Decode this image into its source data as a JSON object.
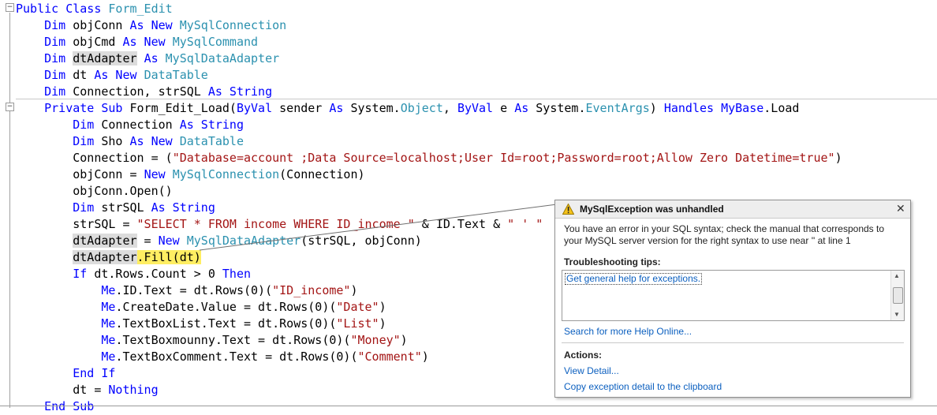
{
  "code": {
    "lines": [
      [
        {
          "t": "Public Class ",
          "c": "kw"
        },
        {
          "t": "Form_Edit",
          "c": "ty"
        }
      ],
      [
        {
          "t": "    Dim ",
          "c": "kw"
        },
        {
          "t": "objConn "
        },
        {
          "t": "As New ",
          "c": "kw"
        },
        {
          "t": "MySqlConnection",
          "c": "ty"
        }
      ],
      [
        {
          "t": "    Dim ",
          "c": "kw"
        },
        {
          "t": "objCmd "
        },
        {
          "t": "As New ",
          "c": "kw"
        },
        {
          "t": "MySqlCommand",
          "c": "ty"
        }
      ],
      [
        {
          "t": "    Dim ",
          "c": "kw"
        },
        {
          "t": "dtAdapter",
          "c": "hl"
        },
        {
          "t": " "
        },
        {
          "t": "As ",
          "c": "kw"
        },
        {
          "t": "MySqlDataAdapter",
          "c": "ty"
        }
      ],
      [
        {
          "t": "    Dim ",
          "c": "kw"
        },
        {
          "t": "dt "
        },
        {
          "t": "As New ",
          "c": "kw"
        },
        {
          "t": "DataTable",
          "c": "ty"
        }
      ],
      [
        {
          "t": "    Dim ",
          "c": "kw"
        },
        {
          "t": "Connection, strSQL "
        },
        {
          "t": "As String",
          "c": "kw"
        }
      ],
      [
        {
          "t": "    Private Sub ",
          "c": "kw"
        },
        {
          "t": "Form_Edit_Load("
        },
        {
          "t": "ByVal ",
          "c": "kw"
        },
        {
          "t": "sender "
        },
        {
          "t": "As ",
          "c": "kw"
        },
        {
          "t": "System."
        },
        {
          "t": "Object",
          "c": "ty"
        },
        {
          "t": ", "
        },
        {
          "t": "ByVal ",
          "c": "kw"
        },
        {
          "t": "e "
        },
        {
          "t": "As ",
          "c": "kw"
        },
        {
          "t": "System."
        },
        {
          "t": "EventArgs",
          "c": "ty"
        },
        {
          "t": ") "
        },
        {
          "t": "Handles MyBase",
          "c": "kw"
        },
        {
          "t": ".Load"
        }
      ],
      [
        {
          "t": "        Dim ",
          "c": "kw"
        },
        {
          "t": "Connection "
        },
        {
          "t": "As String",
          "c": "kw"
        }
      ],
      [
        {
          "t": "        Dim ",
          "c": "kw"
        },
        {
          "t": "Sho "
        },
        {
          "t": "As New ",
          "c": "kw"
        },
        {
          "t": "DataTable",
          "c": "ty"
        }
      ],
      [
        {
          "t": "        Connection = ("
        },
        {
          "t": "\"Database=account ;Data Source=localhost;User Id=root;Password=root;Allow Zero Datetime=true\"",
          "c": "st"
        },
        {
          "t": ")"
        }
      ],
      [
        {
          "t": "        objConn = "
        },
        {
          "t": "New ",
          "c": "kw"
        },
        {
          "t": "MySqlConnection",
          "c": "ty"
        },
        {
          "t": "(Connection)"
        }
      ],
      [
        {
          "t": "        objConn.Open()"
        }
      ],
      [
        {
          "t": "        Dim ",
          "c": "kw"
        },
        {
          "t": "strSQL "
        },
        {
          "t": "As String",
          "c": "kw"
        }
      ],
      [
        {
          "t": "        strSQL = "
        },
        {
          "t": "\"SELECT * FROM income WHERE ID_income \"",
          "c": "st"
        },
        {
          "t": " & ID.Text & "
        },
        {
          "t": "\" ' \"",
          "c": "st"
        }
      ],
      [
        {
          "t": "        "
        },
        {
          "t": "dtAdapter",
          "c": "hl"
        },
        {
          "t": " = "
        },
        {
          "t": "New ",
          "c": "kw"
        },
        {
          "t": "MySqlDataAdapter",
          "c": "ty"
        },
        {
          "t": "(strSQL, objConn)"
        }
      ],
      [
        {
          "t": "        "
        },
        {
          "t": "dtAdapter",
          "c": "hl"
        },
        {
          "t": ".Fill(dt)",
          "c": "cur"
        }
      ],
      [
        {
          "t": "        If ",
          "c": "kw"
        },
        {
          "t": "dt.Rows.Count > 0 "
        },
        {
          "t": "Then",
          "c": "kw"
        }
      ],
      [
        {
          "t": "            Me",
          "c": "kw"
        },
        {
          "t": ".ID.Text = dt.Rows(0)("
        },
        {
          "t": "\"ID_income\"",
          "c": "st"
        },
        {
          "t": ")"
        }
      ],
      [
        {
          "t": "            Me",
          "c": "kw"
        },
        {
          "t": ".CreateDate.Value = dt.Rows(0)("
        },
        {
          "t": "\"Date\"",
          "c": "st"
        },
        {
          "t": ")"
        }
      ],
      [
        {
          "t": "            Me",
          "c": "kw"
        },
        {
          "t": ".TextBoxList.Text = dt.Rows(0)("
        },
        {
          "t": "\"List\"",
          "c": "st"
        },
        {
          "t": ")"
        }
      ],
      [
        {
          "t": "            Me",
          "c": "kw"
        },
        {
          "t": ".TextBoxmounny.Text = dt.Rows(0)("
        },
        {
          "t": "\"Money\"",
          "c": "st"
        },
        {
          "t": ")"
        }
      ],
      [
        {
          "t": "            Me",
          "c": "kw"
        },
        {
          "t": ".TextBoxComment.Text = dt.Rows(0)("
        },
        {
          "t": "\"Comment\"",
          "c": "st"
        },
        {
          "t": ")"
        }
      ],
      [
        {
          "t": "        End If",
          "c": "kw"
        }
      ],
      [
        {
          "t": "        dt = "
        },
        {
          "t": "Nothing",
          "c": "kw"
        }
      ],
      [
        {
          "t": "    End Sub",
          "c": "kw"
        }
      ]
    ]
  },
  "gutter": {
    "fold_glyph": "−"
  },
  "exception": {
    "title": "MySqlException was unhandled",
    "close": "✕",
    "message": "You have an error in your SQL syntax; check the manual that corresponds to your MySQL server version for the right syntax to use near '' at line 1",
    "tips_title": "Troubleshooting tips:",
    "tips": [
      "Get general help for exceptions."
    ],
    "search_link": "Search for more Help Online...",
    "actions_title": "Actions:",
    "actions": [
      "View Detail...",
      "Copy exception detail to the clipboard"
    ]
  },
  "colors": {
    "keyword": "#0000ff",
    "type": "#2b91af",
    "string": "#a31515",
    "current_statement": "#ffee62",
    "reference_highlight": "#dcdcdc",
    "link": "#0b5fbf"
  },
  "icons": {
    "warning": "warning-icon",
    "close": "close-icon"
  }
}
